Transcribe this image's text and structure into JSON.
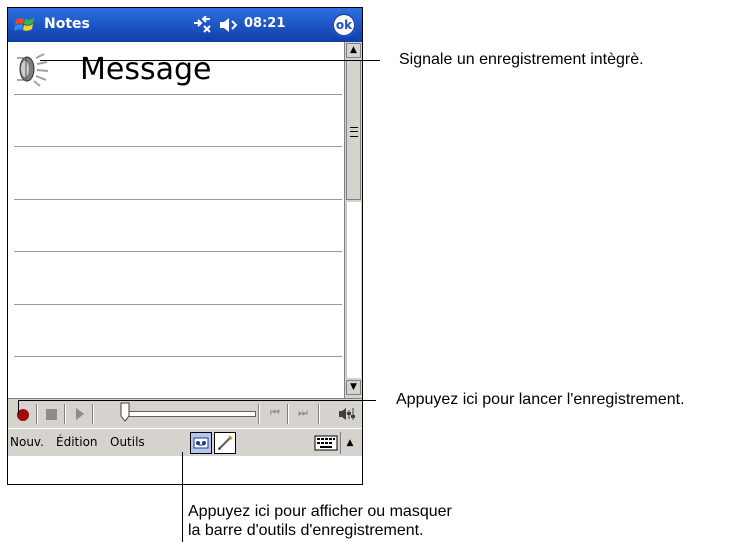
{
  "titlebar": {
    "app_title": "Notes",
    "clock": "08:21",
    "ok_label": "ok"
  },
  "note": {
    "text": "Message"
  },
  "menubar": {
    "items": [
      "Nouv.",
      "Édition",
      "Outils"
    ]
  },
  "callouts": {
    "embedded_recording": "Signale un enregistrement intègrè.",
    "start_recording": "Appuyez ici pour lancer l'enregistrement.",
    "toggle_toolbar_line1": "Appuyez ici pour afficher ou masquer",
    "toggle_toolbar_line2": "la barre d'outils d'enregistrement."
  },
  "colors": {
    "titlebar": "#1a4fc4",
    "record": "#9e0b0b",
    "toolbar": "#d6d3ce"
  },
  "icons": [
    "windows-start-icon",
    "connectivity-icon",
    "volume-icon",
    "speaker-icon",
    "record-icon",
    "stop-icon",
    "play-icon",
    "skip-back-icon",
    "skip-forward-icon",
    "volume-slider-icon",
    "recording-toolbar-icon",
    "pen-icon",
    "keyboard-icon"
  ]
}
